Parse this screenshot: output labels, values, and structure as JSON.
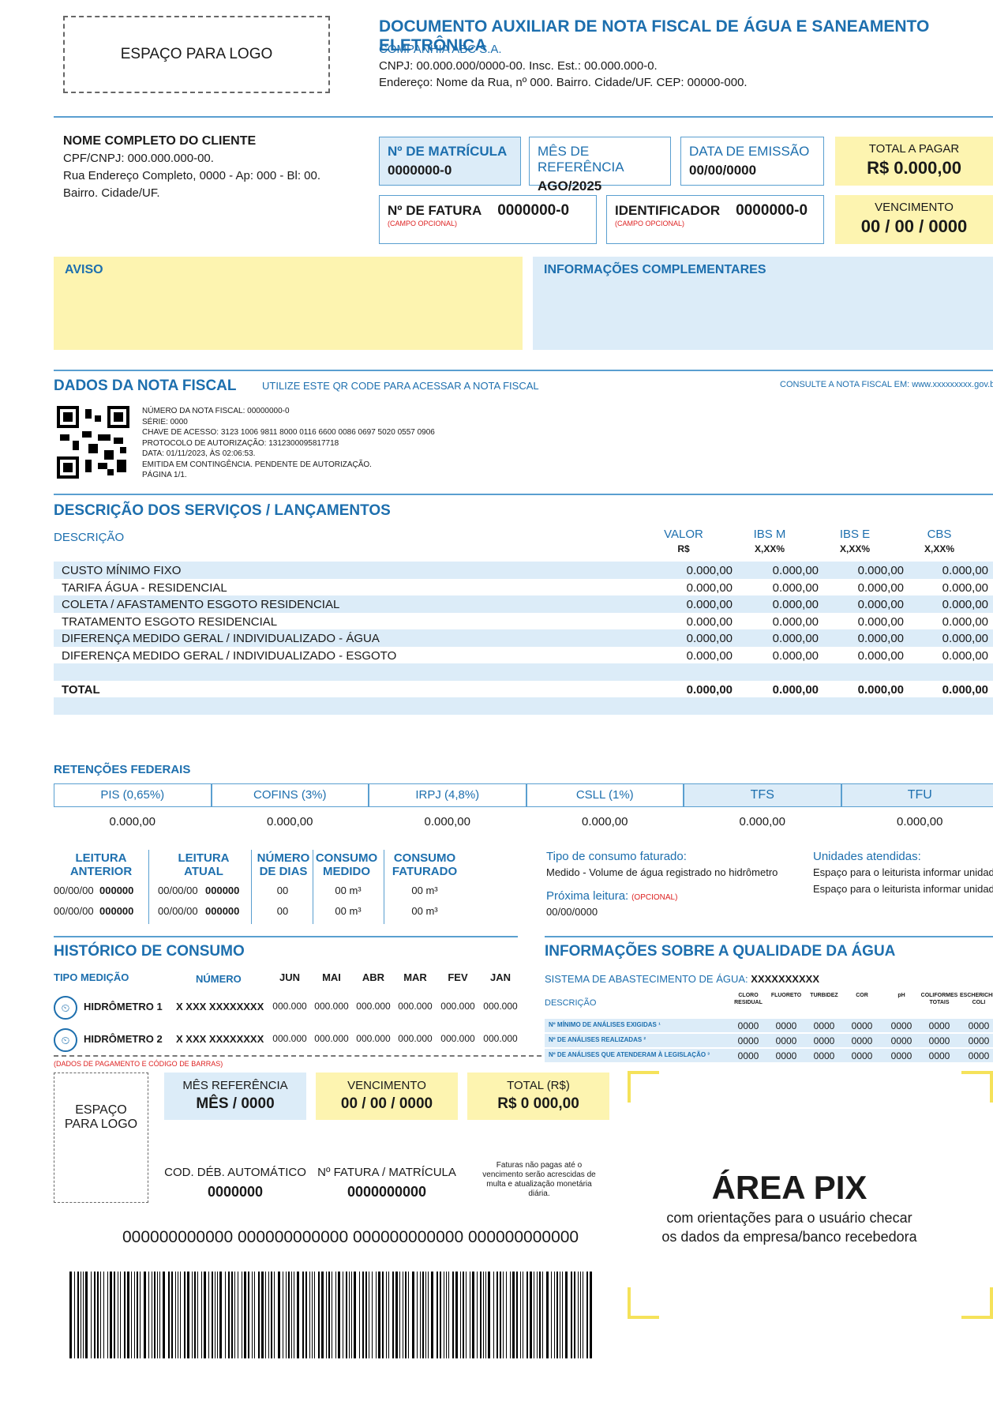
{
  "header": {
    "logo": "ESPAÇO PARA LOGO",
    "title": "DOCUMENTO AUXILIAR DE NOTA FISCAL DE ÁGUA E SANEAMENTO ELETRÔNICA",
    "company": "COMPANHIA ABC S.A.",
    "cnpj": "CNPJ: 00.000.000/0000-00. Insc. Est.: 00.000.000-0.",
    "address": "Endereço: Nome da Rua, nº 000. Bairro. Cidade/UF. CEP: 00000-000."
  },
  "client": {
    "name": "NOME COMPLETO DO CLIENTE",
    "doc": "CPF/CNPJ: 000.000.000-00.",
    "addr1": "Rua Endereço Completo, 0000 - Ap: 000 - Bl: 00.",
    "addr2": "Bairro. Cidade/UF."
  },
  "cards": {
    "matricula_label": "Nº DE MATRÍCULA",
    "matricula": "0000000-0",
    "mes_label": "MÊS DE REFERÊNCIA",
    "mes": "AGO/2025",
    "emissao_label": "DATA DE EMISSÃO",
    "emissao": "00/00/0000",
    "total_label": "TOTAL A PAGAR",
    "total": "R$ 0.000,00",
    "fatura_label": "Nº DE FATURA",
    "fatura": "0000000-0",
    "opcional": "(CAMPO OPCIONAL)",
    "ident_label": "IDENTIFICADOR",
    "ident": "0000000-0",
    "venc_label": "VENCIMENTO",
    "venc": "00 / 00 / 0000"
  },
  "aviso": "AVISO",
  "info_comp": "INFORMAÇÕES COMPLEMENTARES",
  "nf": {
    "title": "DADOS DA NOTA FISCAL",
    "qr_hint": "UTILIZE ESTE QR CODE PARA ACESSAR A NOTA FISCAL",
    "consulte": "CONSULTE A NOTA FISCAL EM: www.xxxxxxxxx.gov.br",
    "lines": [
      "NÚMERO DA NOTA FISCAL: 00000000-0",
      "SÉRIE: 0000",
      "CHAVE DE ACESSO: 3123 1006 9811 8000 0116 6600 0086 0697 5020 0557 0906",
      "PROTOCOLO DE AUTORIZAÇÃO: 1312300095817718",
      "DATA: 01/11/2023, ÀS 02:06:53.",
      "EMITIDA EM CONTINGÊNCIA. PENDENTE DE AUTORIZAÇÃO.",
      "PÁGINA 1/1."
    ]
  },
  "services": {
    "title": "DESCRIÇÃO DOS SERVIÇOS / LANÇAMENTOS",
    "desc": "DESCRIÇÃO",
    "cols": [
      [
        "VALOR",
        "R$"
      ],
      [
        "IBS M",
        "X,XX%"
      ],
      [
        "IBS E",
        "X,XX%"
      ],
      [
        "CBS",
        "X,XX%"
      ]
    ],
    "rows": [
      [
        "CUSTO MÍNIMO FIXO",
        "0.000,00",
        "0.000,00",
        "0.000,00",
        "0.000,00"
      ],
      [
        "TARIFA ÁGUA - RESIDENCIAL",
        "0.000,00",
        "0.000,00",
        "0.000,00",
        "0.000,00"
      ],
      [
        "COLETA / AFASTAMENTO ESGOTO RESIDENCIAL",
        "0.000,00",
        "0.000,00",
        "0.000,00",
        "0.000,00"
      ],
      [
        "TRATAMENTO ESGOTO RESIDENCIAL",
        "0.000,00",
        "0.000,00",
        "0.000,00",
        "0.000,00"
      ],
      [
        "DIFERENÇA MEDIDO GERAL / INDIVIDUALIZADO - ÁGUA",
        "0.000,00",
        "0.000,00",
        "0.000,00",
        "0.000,00"
      ],
      [
        "DIFERENÇA MEDIDO GERAL / INDIVIDUALIZADO - ESGOTO",
        "0.000,00",
        "0.000,00",
        "0.000,00",
        "0.000,00"
      ]
    ],
    "total": [
      "TOTAL",
      "0.000,00",
      "0.000,00",
      "0.000,00",
      "0.000,00"
    ]
  },
  "ret": {
    "title": "RETENÇÕES FEDERAIS",
    "labels": [
      "PIS (0,65%)",
      "COFINS (3%)",
      "IRPJ (4,8%)",
      "CSLL (1%)",
      "TFS",
      "TFU"
    ],
    "values": [
      "0.000,00",
      "0.000,00",
      "0.000,00",
      "0.000,00",
      "0.000,00",
      "0.000,00"
    ]
  },
  "leitura": {
    "h1": "LEITURA",
    "h1b": "ANTERIOR",
    "h2": "LEITURA",
    "h2b": "ATUAL",
    "h3": "NÚMERO",
    "h3b": "DE DIAS",
    "h4": "CONSUMO",
    "h4b": "MEDIDO",
    "h5": "CONSUMO",
    "h5b": "FATURADO",
    "date": "00/00/00",
    "num": "000000",
    "dias": "00",
    "m3": "00 m³"
  },
  "tipo": {
    "label": "Tipo de consumo faturado:",
    "value": "Medido - Volume de água registrado no hidrômetro",
    "prox": "Próxima leitura:",
    "opc": "(OPCIONAL)",
    "prox_v": "00/00/0000",
    "unid": "Unidades atendidas:",
    "unid_v": "Espaço para o leiturista informar unidades"
  },
  "hist": {
    "title": "HISTÓRICO DE CONSUMO",
    "tipo": "TIPO MEDIÇÃO",
    "numero": "NÚMERO",
    "months": [
      "JUN",
      "MAI",
      "ABR",
      "MAR",
      "FEV",
      "JAN"
    ],
    "h1": "HIDRÔMETRO 1",
    "h2": "HIDRÔMETRO 2",
    "num": "X XXX XXXXXXXX",
    "val": "000.000"
  },
  "qual": {
    "title": "INFORMAÇÕES SOBRE A QUALIDADE DA ÁGUA",
    "sistema": "SISTEMA DE ABASTECIMENTO DE ÁGUA:",
    "sistema_v": "XXXXXXXXXX",
    "desc": "DESCRIÇÃO",
    "cols": [
      "CLORO RESIDUAL",
      "FLUORETO",
      "TURBIDEZ",
      "COR",
      "pH",
      "COLIFORMES TOTAIS",
      "ESCHERICHIA COLI"
    ],
    "rows": [
      "Nº MÍNIMO DE ANÁLISES EXIGIDAS ¹",
      "Nº DE ANÁLISES REALIZADAS ²",
      "Nº DE ANÁLISES QUE ATENDERAM À LEGISLAÇÃO ³"
    ],
    "val": "0000"
  },
  "pay": {
    "note": "(DADOS DE PAGAMENTO E CÓDIGO DE BARRAS)",
    "logo": "ESPAÇO PARA LOGO",
    "mes_l": "MÊS REFERÊNCIA",
    "mes": "MÊS / 0000",
    "venc_l": "VENCIMENTO",
    "venc": "00 / 00 / 0000",
    "tot_l": "TOTAL (R$)",
    "tot": "R$ 0 000,00",
    "deb_l": "COD. DÉB. AUTOMÁTICO",
    "deb": "0000000",
    "fat_l": "Nº FATURA / MATRÍCULA",
    "fat": "0000000000",
    "aviso": "Faturas não pagas até o vencimento serão acrescidas de multa e atualização monetária diária.",
    "code": "000000000000 000000000000 000000000000 000000000000",
    "pix": "ÁREA PIX",
    "pix1": "com orientações para o usuário checar",
    "pix2": "os dados da empresa/banco recebedora"
  }
}
